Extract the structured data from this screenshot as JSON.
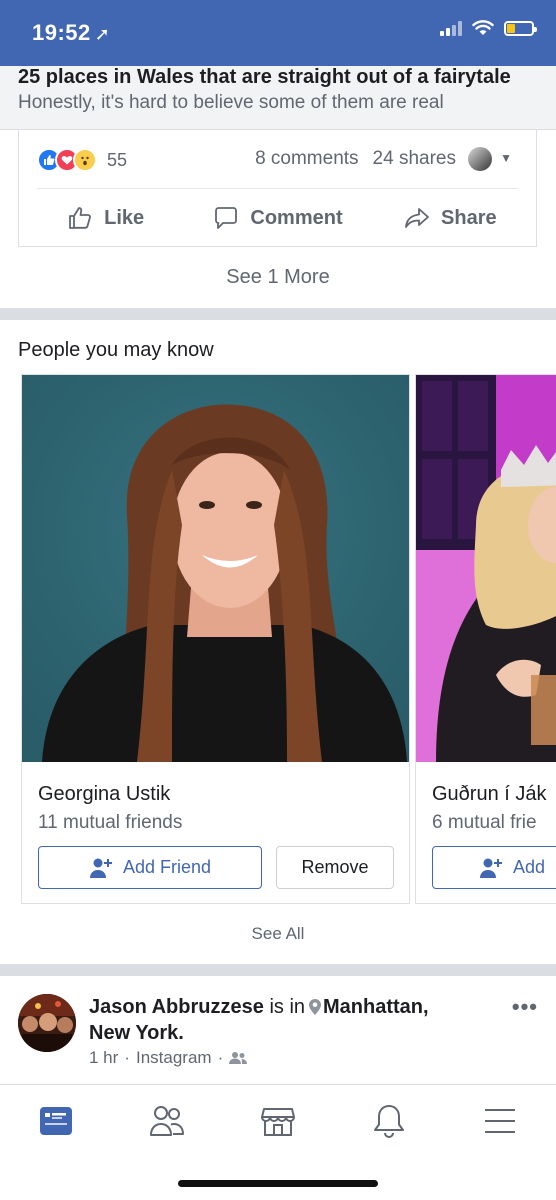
{
  "status": {
    "time": "19:52",
    "battery_level": 0.35
  },
  "link_preview": {
    "title": "25 places in Wales that are straight out of a fairytale",
    "subtitle": "Honestly, it's hard to believe some of them are real"
  },
  "post": {
    "reactions_count": "55",
    "comments": "8 comments",
    "shares": "24 shares",
    "actions": {
      "like": "Like",
      "comment": "Comment",
      "share": "Share"
    }
  },
  "see_more": "See 1 More",
  "pymk": {
    "title": "People you may know",
    "people": [
      {
        "name": "Georgina Ustik",
        "mutual": "11 mutual friends"
      },
      {
        "name": "Guðrun í Ják",
        "mutual": "6 mutual frie"
      }
    ],
    "add_friend_label": "Add Friend",
    "add_friend_label_truncated": "Add",
    "remove_label": "Remove",
    "see_all": "See All"
  },
  "feed_post": {
    "author": "Jason Abbruzzese",
    "is_in": "is in",
    "place_line1": "Manhattan,",
    "place_line2": "New York.",
    "time": "1 hr",
    "source": "Instagram",
    "more": "•••"
  },
  "colors": {
    "brand_blue": "#4267b2",
    "text_secondary": "#606770",
    "divider": "#dadde1"
  }
}
